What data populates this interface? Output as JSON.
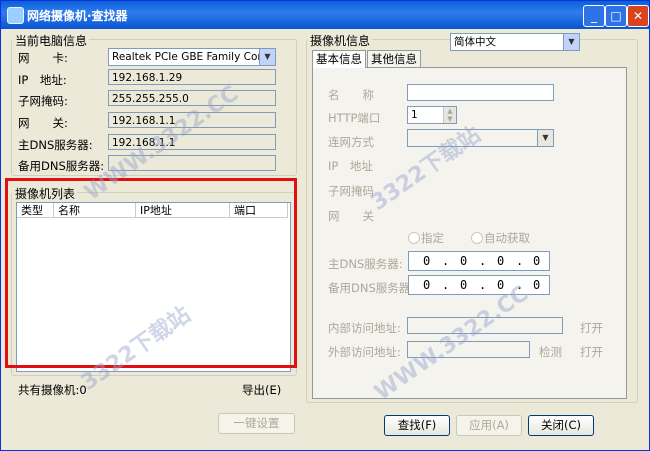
{
  "window": {
    "title": "网络摄像机·查找器"
  },
  "left_group": {
    "title": "当前电脑信息",
    "nic_label": "网　　卡:",
    "nic_value": "Realtek PCIe GBE Family Con",
    "ip_label": "IP　地址:",
    "ip_value": "192.168.1.29",
    "mask_label": "子网掩码:",
    "mask_value": "255.255.255.0",
    "gateway_label": "网　　关:",
    "gateway_value": "192.168.1.1",
    "dns1_label": "主DNS服务器:",
    "dns1_value": "192.168.1.1",
    "dns2_label": "备用DNS服务器:",
    "dns2_value": ""
  },
  "camera_list": {
    "title": "摄像机列表",
    "columns": [
      "类型",
      "名称",
      "IP地址",
      "端口"
    ],
    "count_label": "共有摄像机:0",
    "export_label": "导出(E)"
  },
  "right_group": {
    "title": "摄像机信息",
    "language": "简体中文",
    "tabs": [
      "基本信息",
      "其他信息"
    ],
    "name_label": "名　　称",
    "http_port_label": "HTTP端口",
    "http_port_value": "1",
    "connect_mode_label": "连网方式",
    "ip_label": "IP　地址",
    "mask_label": "子网掩码",
    "gateway_label": "网　　关",
    "radio_fixed": "指定",
    "radio_auto": "自动获取",
    "dns1_label": "主DNS服务器:",
    "dns2_label": "备用DNS服务器:",
    "dns1_octets": [
      "0",
      "0",
      "0",
      "0"
    ],
    "dns2_octets": [
      "0",
      "0",
      "0",
      "0"
    ],
    "inner_addr_label": "内部访问地址:",
    "outer_addr_label": "外部访问地址:",
    "open_label": "打开",
    "detect_label": "检测",
    "open2_label": "打开"
  },
  "buttons": {
    "one_click": "一键设置",
    "search": "查找(F)",
    "apply": "应用(A)",
    "close": "关闭(C)"
  },
  "watermark": "WWW.3322.CC",
  "watermark2": "3322下载站"
}
